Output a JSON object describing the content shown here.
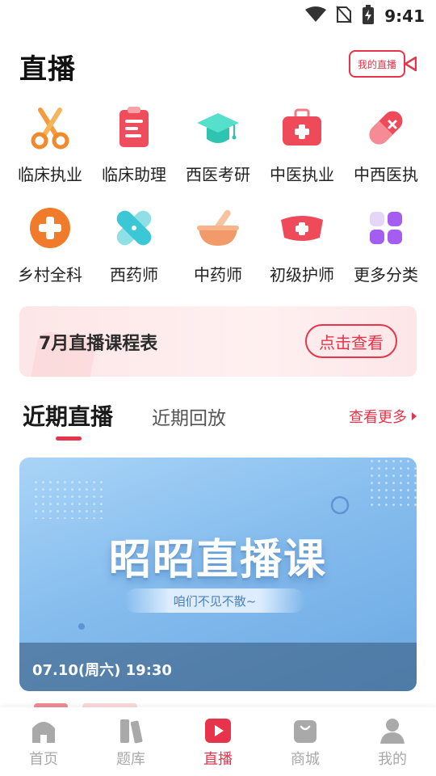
{
  "status_bar": {
    "time": "9:41",
    "icons": [
      "wifi-icon",
      "no-sim-icon",
      "battery-charging-icon"
    ]
  },
  "header": {
    "title": "直播",
    "my_live_label": "我的直播"
  },
  "categories": [
    {
      "label": "临床执业",
      "icon": "scissors-icon"
    },
    {
      "label": "临床助理",
      "icon": "clipboard-icon"
    },
    {
      "label": "西医考研",
      "icon": "graduation-cap-icon"
    },
    {
      "label": "中医执业",
      "icon": "medical-kit-icon"
    },
    {
      "label": "中西医执",
      "icon": "pill-capsule-icon"
    },
    {
      "label": "乡村全科",
      "icon": "plus-circle-icon"
    },
    {
      "label": "西药师",
      "icon": "bandage-icon"
    },
    {
      "label": "中药师",
      "icon": "mortar-pestle-icon"
    },
    {
      "label": "初级护师",
      "icon": "nurse-cap-icon"
    },
    {
      "label": "更多分类",
      "icon": "grid-apps-icon"
    }
  ],
  "banner": {
    "title": "7月直播课程表",
    "button": "点击查看"
  },
  "tabs": {
    "active": "近期直播",
    "inactive": "近期回放",
    "see_more": "查看更多"
  },
  "live_card": {
    "title": "昭昭直播课",
    "subtitle": "咱们不见不散~",
    "time": "07.10(周六) 19:30"
  },
  "bottom_nav": [
    {
      "label": "首页",
      "icon": "home-icon",
      "active": false
    },
    {
      "label": "题库",
      "icon": "books-icon",
      "active": false
    },
    {
      "label": "直播",
      "icon": "play-icon",
      "active": true
    },
    {
      "label": "商城",
      "icon": "shopping-bag-icon",
      "active": false
    },
    {
      "label": "我的",
      "icon": "profile-icon",
      "active": false
    }
  ],
  "colors": {
    "accent": "#e8344a",
    "inactive_nav": "#a9a9a9"
  }
}
